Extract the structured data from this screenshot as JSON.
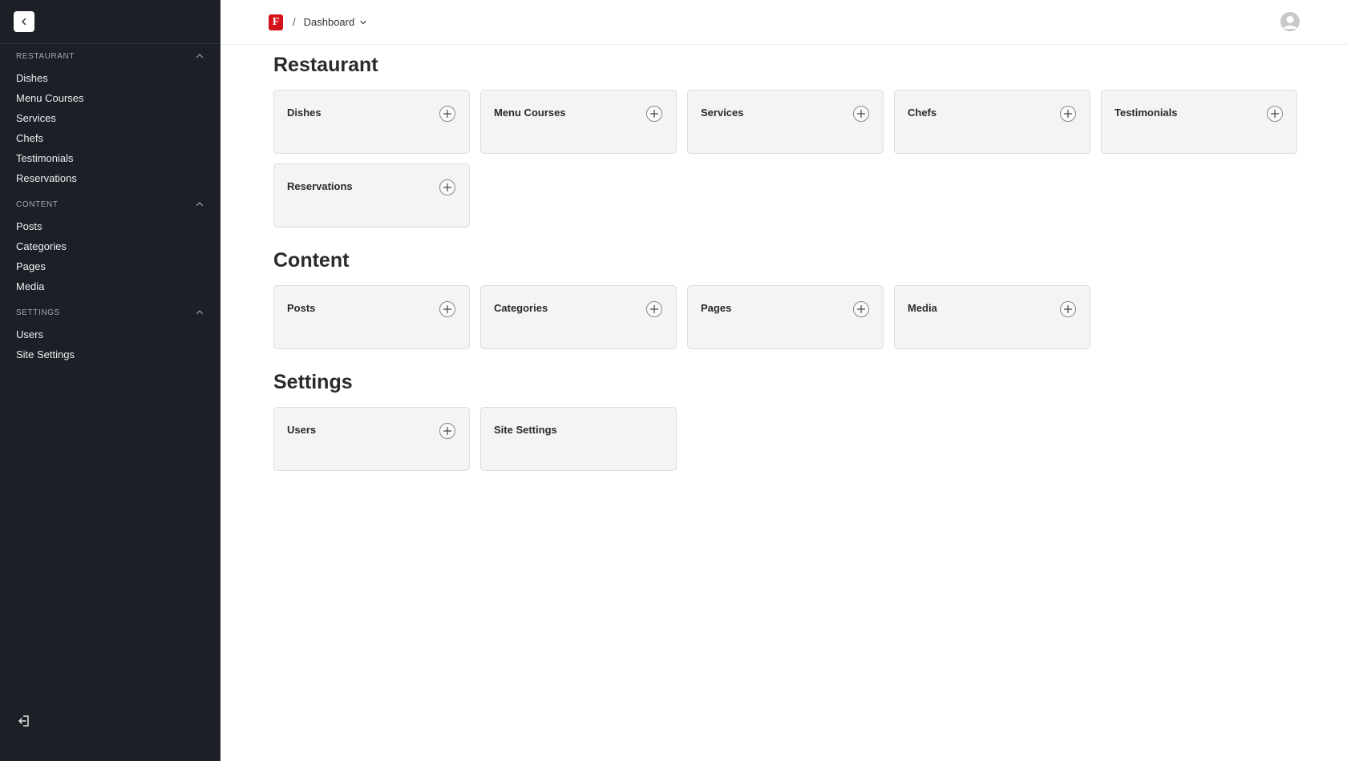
{
  "sidebar": {
    "groups": [
      {
        "label": "RESTAURANT",
        "items": [
          "Dishes",
          "Menu Courses",
          "Services",
          "Chefs",
          "Testimonials",
          "Reservations"
        ]
      },
      {
        "label": "CONTENT",
        "items": [
          "Posts",
          "Categories",
          "Pages",
          "Media"
        ]
      },
      {
        "label": "SETTINGS",
        "items": [
          "Users",
          "Site Settings"
        ]
      }
    ],
    "icons": {
      "collapse": "chevron-left-icon",
      "logout": "logout-icon",
      "group_toggle": "chevron-up-icon"
    }
  },
  "header": {
    "logo_letter": "F",
    "separator": "/",
    "breadcrumb": "Dashboard",
    "brand_color": "#d4121b"
  },
  "main": {
    "sections": [
      {
        "title": "Restaurant",
        "cards": [
          {
            "label": "Dishes",
            "addable": true
          },
          {
            "label": "Menu Courses",
            "addable": true
          },
          {
            "label": "Services",
            "addable": true
          },
          {
            "label": "Chefs",
            "addable": true
          },
          {
            "label": "Testimonials",
            "addable": true
          },
          {
            "label": "Reservations",
            "addable": true
          }
        ]
      },
      {
        "title": "Content",
        "cards": [
          {
            "label": "Posts",
            "addable": true
          },
          {
            "label": "Categories",
            "addable": true
          },
          {
            "label": "Pages",
            "addable": true
          },
          {
            "label": "Media",
            "addable": true
          }
        ]
      },
      {
        "title": "Settings",
        "cards": [
          {
            "label": "Users",
            "addable": true
          },
          {
            "label": "Site Settings",
            "addable": false
          }
        ]
      }
    ]
  }
}
